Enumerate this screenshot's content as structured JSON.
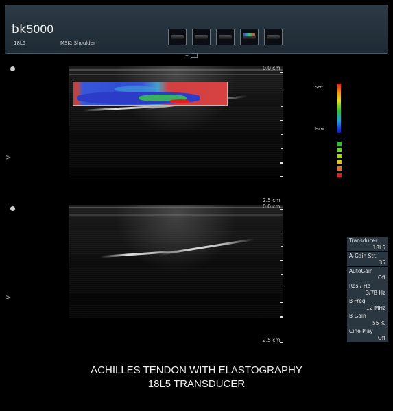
{
  "header": {
    "logo_prefix": "bk",
    "logo_model": "5000",
    "probe": "18L5",
    "preset": "MSK: Shoulder",
    "thumbnail_icons": [
      "image-thumb-1",
      "image-thumb-2",
      "image-thumb-3",
      "image-thumb-4",
      "image-thumb-5"
    ]
  },
  "image_top": {
    "depth_top": "0.0 cm",
    "depth_bottom": "2.5 cm"
  },
  "image_bottom": {
    "depth_top": "0.0 cm",
    "depth_bottom": "2.5 cm"
  },
  "color_scale": {
    "soft_label": "Soft",
    "hard_label": "Hard",
    "strain_colors": [
      "#2ec02e",
      "#6ad02a",
      "#a8d020",
      "#e0c020",
      "#e07020",
      "#d82020"
    ]
  },
  "side_markers": [
    ">",
    ">"
  ],
  "params": [
    {
      "label": "Transducer",
      "value": "18L5"
    },
    {
      "label": "A-Gain Str.",
      "value": "35"
    },
    {
      "label": "AutoGain",
      "value": "Off"
    },
    {
      "label": "Res / Hz",
      "value": "3/78 Hz"
    },
    {
      "label": "B Freq",
      "value": "12 MHz"
    },
    {
      "label": "B Gain",
      "value": "55 %"
    },
    {
      "label": "Cine Play",
      "value": "Off"
    }
  ],
  "caption": {
    "line1": "ACHILLES TENDON WITH ELASTOGRAPHY",
    "line2": "18L5 TRANSDUCER"
  }
}
